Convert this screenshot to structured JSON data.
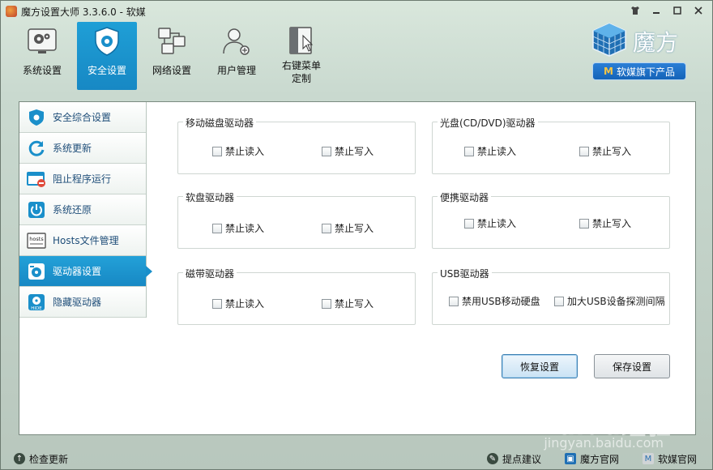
{
  "window": {
    "title": "魔方设置大师 3.3.6.0 - 软媒"
  },
  "toolbar": {
    "items": [
      {
        "label": "系统设置"
      },
      {
        "label": "安全设置"
      },
      {
        "label": "网络设置"
      },
      {
        "label": "用户管理"
      },
      {
        "label": "右键菜单\n定制"
      }
    ],
    "active_index": 1
  },
  "brand": {
    "name": "魔方",
    "badge": "软媒旗下产品",
    "badge_mark": "M"
  },
  "sidebar": {
    "items": [
      {
        "label": "安全综合设置",
        "icon": "shield-icon"
      },
      {
        "label": "系统更新",
        "icon": "refresh-icon"
      },
      {
        "label": "阻止程序运行",
        "icon": "block-window-icon"
      },
      {
        "label": "系统还原",
        "icon": "power-restore-icon"
      },
      {
        "label": "Hosts文件管理",
        "icon": "hosts-file-icon",
        "icon_text": "hosts"
      },
      {
        "label": "驱动器设置",
        "icon": "drive-settings-icon"
      },
      {
        "label": "隐藏驱动器",
        "icon": "hide-drive-icon",
        "icon_text": "HIDE"
      }
    ],
    "active_index": 5
  },
  "groups": {
    "removable": {
      "title": "移动磁盘驱动器",
      "opt1": "禁止读入",
      "opt2": "禁止写入"
    },
    "optical": {
      "title": "光盘(CD/DVD)驱动器",
      "opt1": "禁止读入",
      "opt2": "禁止写入"
    },
    "floppy": {
      "title": "软盘驱动器",
      "opt1": "禁止读入",
      "opt2": "禁止写入"
    },
    "portable": {
      "title": "便携驱动器",
      "opt1": "禁止读入",
      "opt2": "禁止写入"
    },
    "tape": {
      "title": "磁带驱动器",
      "opt1": "禁止读入",
      "opt2": "禁止写入"
    },
    "usb": {
      "title": "USB驱动器",
      "opt1": "禁用USB移动硬盘",
      "opt2": "加大USB设备探测间隔"
    }
  },
  "buttons": {
    "restore": "恢复设置",
    "save": "保存设置"
  },
  "statusbar": {
    "check_update": "检查更新",
    "feedback": "提点建议",
    "site_mofang": "魔方官网",
    "site_ruanmei": "软媒官网"
  },
  "watermark": {
    "main": "Baidu经验",
    "sub": "jingyan.baidu.com"
  }
}
